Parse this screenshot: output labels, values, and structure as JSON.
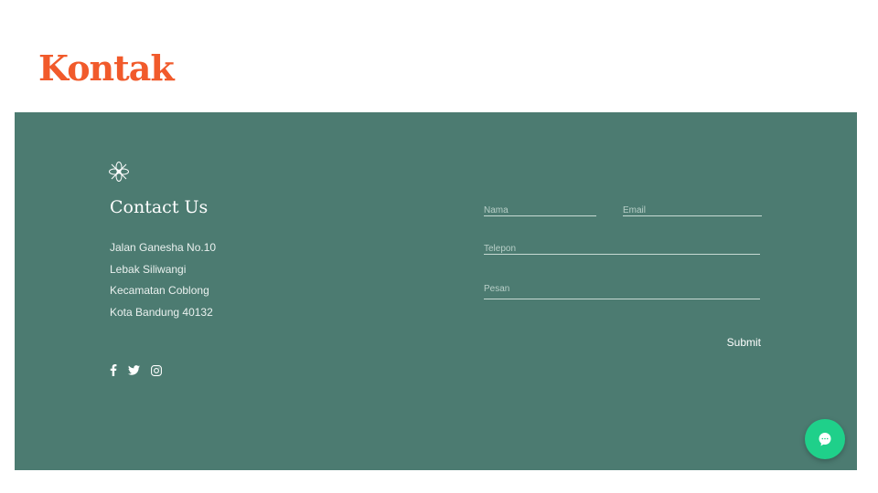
{
  "page": {
    "title": "Kontak"
  },
  "contact": {
    "heading": "Contact Us",
    "address": [
      "Jalan Ganesha No.10",
      "Lebak Siliwangi",
      "Kecamatan Coblong",
      "Kota Bandung 40132"
    ],
    "social_icons": [
      "facebook-icon",
      "twitter-icon",
      "instagram-icon"
    ],
    "logo_icon": "flower-logo-icon"
  },
  "form": {
    "name_placeholder": "Nama",
    "email_placeholder": "Email",
    "phone_placeholder": "Telepon",
    "message_placeholder": "Pesan",
    "submit_label": "Submit"
  },
  "chat_widget": {
    "icon": "chat-bubble-icon"
  },
  "colors": {
    "title": "#f15a2b",
    "panel_bg": "#4c7b71",
    "chat_button": "#1fd08a"
  }
}
